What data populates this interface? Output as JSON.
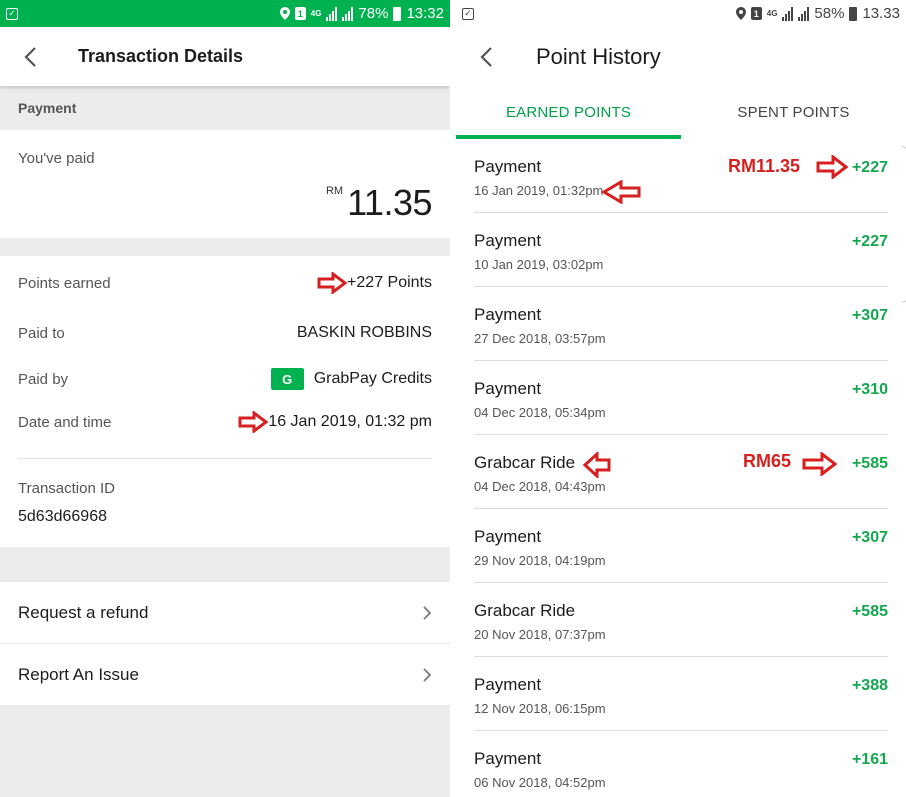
{
  "left_screen": {
    "status": {
      "battery": "78%",
      "time": "13:32",
      "net": "4G"
    },
    "header_title": "Transaction Details",
    "section_label": "Payment",
    "paid_label": "You've paid",
    "currency": "RM",
    "amount": "11.35",
    "points_label": "Points earned",
    "points_value": "+227 Points",
    "paid_to_label": "Paid to",
    "paid_to_value": "BASKIN ROBBINS",
    "paid_by_label": "Paid by",
    "paid_by_icon": "G",
    "paid_by_value": "GrabPay Credits",
    "datetime_label": "Date and time",
    "datetime_value": "16 Jan 2019, 01:32 pm",
    "txid_label": "Transaction ID",
    "txid_value": "5d63d66968",
    "actions": [
      "Request a refund",
      "Report An Issue"
    ]
  },
  "right_screen": {
    "status": {
      "battery": "58%",
      "time": "13.33",
      "net": "4G"
    },
    "header_title": "Point History",
    "tabs": [
      "EARNED POINTS",
      "SPENT POINTS"
    ],
    "items": [
      {
        "title": "Payment",
        "date": "16 Jan 2019, 01:32pm",
        "points": "+227"
      },
      {
        "title": "Payment",
        "date": "10 Jan 2019, 03:02pm",
        "points": "+227"
      },
      {
        "title": "Payment",
        "date": "27 Dec 2018, 03:57pm",
        "points": "+307"
      },
      {
        "title": "Payment",
        "date": "04 Dec 2018, 05:34pm",
        "points": "+310"
      },
      {
        "title": "Grabcar Ride",
        "date": "04 Dec 2018, 04:43pm",
        "points": "+585"
      },
      {
        "title": "Payment",
        "date": "29 Nov 2018, 04:19pm",
        "points": "+307"
      },
      {
        "title": "Grabcar Ride",
        "date": "20 Nov 2018, 07:37pm",
        "points": "+585"
      },
      {
        "title": "Payment",
        "date": "12 Nov 2018, 06:15pm",
        "points": "+388"
      },
      {
        "title": "Payment",
        "date": "06 Nov 2018, 04:52pm",
        "points": "+161"
      }
    ],
    "annotations": [
      "RM11.35",
      "RM65"
    ]
  },
  "colors": {
    "brand_green": "#00b14f",
    "points_green": "#13a84e",
    "annotation_red": "#d61f1f"
  },
  "icons": [
    "back-arrow-icon",
    "chevron-right-icon",
    "grabpay-icon",
    "red-arrow-annotation-icon",
    "location-icon",
    "signal-icon",
    "battery-icon"
  ]
}
